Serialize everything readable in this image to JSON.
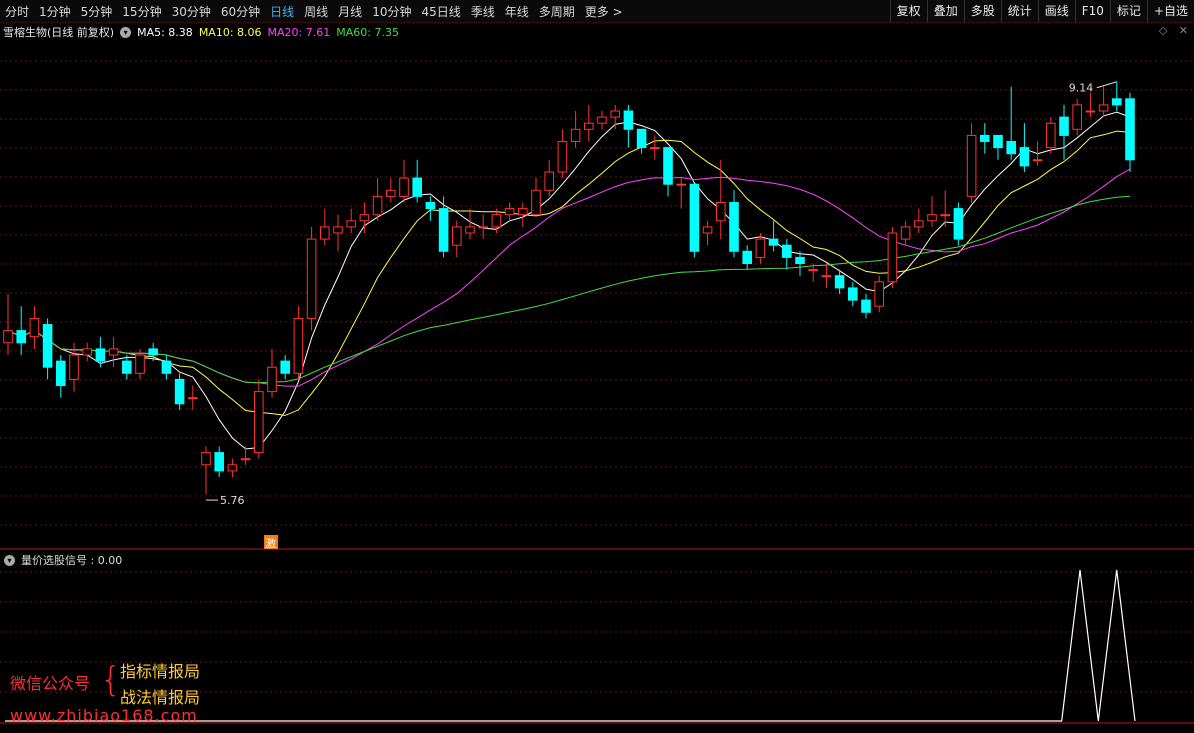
{
  "toolbar": {
    "periods": [
      "分时",
      "1分钟",
      "5分钟",
      "15分钟",
      "30分钟",
      "60分钟",
      "日线",
      "周线",
      "月线",
      "10分钟",
      "45日线",
      "季线",
      "年线",
      "多周期",
      "更多 >"
    ],
    "active_period": "日线",
    "tools": [
      "复权",
      "叠加",
      "多股",
      "统计",
      "画线",
      "F10",
      "标记",
      "+自选"
    ]
  },
  "main": {
    "title": "雪榕生物(日线 前复权)",
    "ma": [
      {
        "label": "MA5: 8.38",
        "color": "#ffffff"
      },
      {
        "label": "MA10: 8.06",
        "color": "#ffff55"
      },
      {
        "label": "MA20: 7.61",
        "color": "#ff44ff"
      },
      {
        "label": "MA60: 7.35",
        "color": "#44dd44"
      }
    ],
    "high_label": "9.14",
    "low_label": "5.76",
    "signal_badge": "激"
  },
  "sub": {
    "title": "量价选股信号 : 0.00"
  },
  "watermark": {
    "line1": "微信公众号",
    "opt1": "指标情报局",
    "opt2": "战法情报局",
    "url": "www.zhibiao168.com"
  },
  "colors": {
    "up": "#ff3232",
    "down": "#00ffff",
    "grid": "#6e1010",
    "ma5": "#ffffff",
    "ma10": "#ffff55",
    "ma20": "#ff44ff",
    "ma60": "#44dd44"
  },
  "chart_data": {
    "type": "candlestick",
    "price_range": [
      5.4,
      9.4
    ],
    "candles": [
      [
        7.0,
        7.1,
        7.4,
        6.9
      ],
      [
        7.1,
        7.0,
        7.3,
        6.9
      ],
      [
        7.05,
        7.2,
        7.3,
        6.95
      ],
      [
        7.15,
        6.8,
        7.2,
        6.7
      ],
      [
        6.85,
        6.65,
        6.9,
        6.55
      ],
      [
        6.7,
        6.9,
        7.0,
        6.6
      ],
      [
        6.9,
        6.95,
        7.0,
        6.85
      ],
      [
        6.95,
        6.85,
        7.05,
        6.8
      ],
      [
        6.9,
        6.95,
        7.05,
        6.8
      ],
      [
        6.85,
        6.75,
        6.9,
        6.7
      ],
      [
        6.75,
        6.9,
        6.95,
        6.7
      ],
      [
        6.95,
        6.9,
        7.0,
        6.85
      ],
      [
        6.85,
        6.75,
        6.9,
        6.7
      ],
      [
        6.7,
        6.5,
        6.75,
        6.45
      ],
      [
        6.55,
        6.55,
        6.65,
        6.45
      ],
      [
        6.0,
        6.1,
        6.15,
        5.76
      ],
      [
        6.1,
        5.95,
        6.15,
        5.9
      ],
      [
        5.95,
        6.0,
        6.05,
        5.9
      ],
      [
        6.05,
        6.05,
        6.15,
        6.0
      ],
      [
        6.1,
        6.6,
        6.7,
        6.05
      ],
      [
        6.6,
        6.8,
        6.95,
        6.55
      ],
      [
        6.85,
        6.75,
        6.9,
        6.7
      ],
      [
        6.75,
        7.2,
        7.3,
        6.7
      ],
      [
        7.2,
        7.85,
        7.95,
        7.1
      ],
      [
        7.85,
        7.95,
        8.1,
        7.8
      ],
      [
        7.9,
        7.95,
        8.05,
        7.75
      ],
      [
        7.95,
        8.0,
        8.1,
        7.9
      ],
      [
        8.0,
        8.05,
        8.15,
        7.9
      ],
      [
        8.05,
        8.2,
        8.35,
        8.0
      ],
      [
        8.2,
        8.25,
        8.35,
        8.15
      ],
      [
        8.2,
        8.35,
        8.5,
        8.15
      ],
      [
        8.35,
        8.2,
        8.5,
        8.15
      ],
      [
        8.15,
        8.1,
        8.2,
        8.0
      ],
      [
        8.1,
        7.75,
        8.2,
        7.7
      ],
      [
        7.8,
        7.95,
        8.0,
        7.7
      ],
      [
        7.9,
        7.95,
        8.1,
        7.85
      ],
      [
        7.95,
        7.95,
        8.05,
        7.85
      ],
      [
        7.95,
        8.05,
        8.1,
        7.9
      ],
      [
        8.05,
        8.1,
        8.15,
        8.0
      ],
      [
        8.05,
        8.1,
        8.15,
        7.95
      ],
      [
        8.05,
        8.25,
        8.35,
        8.05
      ],
      [
        8.25,
        8.4,
        8.5,
        8.2
      ],
      [
        8.4,
        8.65,
        8.75,
        8.35
      ],
      [
        8.65,
        8.75,
        8.9,
        8.6
      ],
      [
        8.75,
        8.8,
        8.95,
        8.65
      ],
      [
        8.8,
        8.85,
        8.9,
        8.75
      ],
      [
        8.85,
        8.9,
        8.95,
        8.75
      ],
      [
        8.9,
        8.75,
        8.95,
        8.6
      ],
      [
        8.75,
        8.6,
        8.75,
        8.55
      ],
      [
        8.6,
        8.6,
        8.7,
        8.5
      ],
      [
        8.6,
        8.3,
        8.6,
        8.2
      ],
      [
        8.3,
        8.3,
        8.35,
        8.1
      ],
      [
        8.3,
        7.75,
        8.3,
        7.7
      ],
      [
        7.9,
        7.95,
        8.0,
        7.8
      ],
      [
        8.0,
        8.15,
        8.5,
        7.85
      ],
      [
        8.15,
        7.75,
        8.25,
        7.7
      ],
      [
        7.75,
        7.65,
        7.8,
        7.6
      ],
      [
        7.7,
        7.85,
        7.9,
        7.65
      ],
      [
        7.85,
        7.8,
        8.0,
        7.75
      ],
      [
        7.8,
        7.7,
        7.85,
        7.6
      ],
      [
        7.7,
        7.65,
        7.75,
        7.55
      ],
      [
        7.6,
        7.6,
        7.65,
        7.5
      ],
      [
        7.55,
        7.55,
        7.65,
        7.45
      ],
      [
        7.55,
        7.45,
        7.6,
        7.4
      ],
      [
        7.45,
        7.35,
        7.5,
        7.3
      ],
      [
        7.35,
        7.25,
        7.4,
        7.2
      ],
      [
        7.3,
        7.5,
        7.55,
        7.25
      ],
      [
        7.5,
        7.9,
        7.95,
        7.45
      ],
      [
        7.85,
        7.95,
        8.0,
        7.8
      ],
      [
        7.95,
        8.0,
        8.1,
        7.9
      ],
      [
        8.0,
        8.05,
        8.2,
        7.95
      ],
      [
        8.05,
        8.05,
        8.25,
        7.95
      ],
      [
        8.1,
        7.85,
        8.15,
        7.8
      ],
      [
        8.2,
        8.7,
        8.8,
        8.15
      ],
      [
        8.7,
        8.65,
        8.8,
        8.55
      ],
      [
        8.7,
        8.6,
        8.7,
        8.5
      ],
      [
        8.65,
        8.55,
        9.1,
        8.5
      ],
      [
        8.6,
        8.45,
        8.8,
        8.4
      ],
      [
        8.5,
        8.5,
        8.65,
        8.45
      ],
      [
        8.6,
        8.8,
        8.85,
        8.55
      ],
      [
        8.85,
        8.7,
        8.95,
        8.5
      ],
      [
        8.75,
        8.95,
        9.0,
        8.7
      ],
      [
        8.9,
        8.9,
        9.05,
        8.85
      ],
      [
        8.9,
        8.95,
        9.1,
        8.85
      ],
      [
        9.0,
        8.95,
        9.14,
        8.9
      ],
      [
        9.0,
        8.5,
        9.05,
        8.4
      ]
    ],
    "signals": [
      0,
      0,
      1,
      0,
      1
    ]
  }
}
